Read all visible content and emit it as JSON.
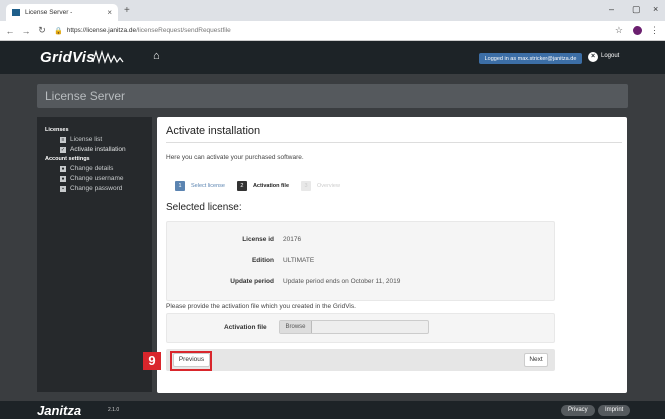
{
  "browser": {
    "tab_title": "License Server -",
    "tab_close": "×",
    "new_tab": "+",
    "win_min": "–",
    "win_max": "▢",
    "win_close": "×",
    "url_host": "https://license.janitza.de",
    "url_path": "/licenseRequest/sendRequestfile"
  },
  "header": {
    "logo": "GridVis",
    "logged_in": "Logged in as max.stricker@janitza.de",
    "logout": "Logout"
  },
  "banner": {
    "title": "License Server"
  },
  "sidebar": {
    "licenses_heading": "Licenses",
    "license_items": [
      {
        "label": "License list"
      },
      {
        "label": "Activate installation"
      }
    ],
    "account_heading": "Account settings",
    "account_items": [
      {
        "label": "Change details"
      },
      {
        "label": "Change username"
      },
      {
        "label": "Change password"
      }
    ]
  },
  "main": {
    "title": "Activate installation",
    "intro": "Here you can activate your purchased software.",
    "steps": [
      {
        "num": "1",
        "label": "Select license"
      },
      {
        "num": "2",
        "label": "Activation file"
      },
      {
        "num": "3",
        "label": "Overview"
      }
    ],
    "section_title": "Selected license:",
    "license": {
      "id_label": "License id",
      "id_value": "20176",
      "edition_label": "Edition",
      "edition_value": "ULTIMATE",
      "update_label": "Update period",
      "update_value": "Update period ends on October 11, 2019"
    },
    "provide_text": "Please provide the activation file which you created in the GridVis.",
    "file_label": "Activation file",
    "browse": "Browse",
    "previous": "Previous",
    "next": "Next"
  },
  "step_marker": "9",
  "footer": {
    "brand": "Janitza",
    "version": "2.1.0",
    "privacy": "Privacy",
    "imprint": "Imprint"
  },
  "colors": {
    "accent": "#5b84b1",
    "highlight": "#d9262c",
    "header_bg": "#1d2327"
  }
}
